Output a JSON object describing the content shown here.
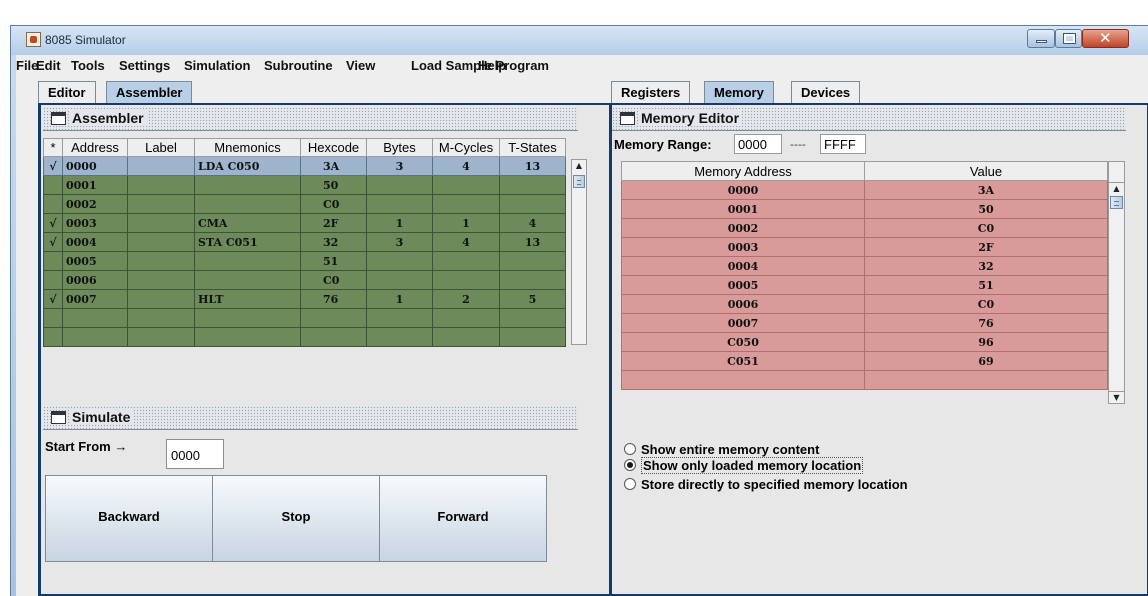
{
  "window": {
    "title": "8085 Simulator"
  },
  "menu": [
    "File",
    "Edit",
    "Tools",
    "Settings",
    "Simulation",
    "Subroutine",
    "View",
    "Load Sample Program",
    "Help"
  ],
  "left_tabs": [
    {
      "label": "Editor",
      "active": false
    },
    {
      "label": "Assembler",
      "active": true
    }
  ],
  "right_tabs": [
    {
      "label": "Registers",
      "active": false
    },
    {
      "label": "Memory",
      "active": true
    },
    {
      "label": "Devices",
      "active": false
    }
  ],
  "assembler": {
    "title": "Assembler",
    "columns": [
      "*",
      "Address",
      "Label",
      "Mnemonics",
      "Hexcode",
      "Bytes",
      "M-Cycles",
      "T-States"
    ],
    "rows": [
      {
        "mark": "√",
        "address": "0000",
        "label": "",
        "mnemonic": "LDA C050",
        "hex": "3A",
        "bytes": "3",
        "mcycles": "4",
        "tstates": "13"
      },
      {
        "mark": "",
        "address": "0001",
        "label": "",
        "mnemonic": "",
        "hex": "50",
        "bytes": "",
        "mcycles": "",
        "tstates": ""
      },
      {
        "mark": "",
        "address": "0002",
        "label": "",
        "mnemonic": "",
        "hex": "C0",
        "bytes": "",
        "mcycles": "",
        "tstates": ""
      },
      {
        "mark": "√",
        "address": "0003",
        "label": "",
        "mnemonic": "CMA",
        "hex": "2F",
        "bytes": "1",
        "mcycles": "1",
        "tstates": "4"
      },
      {
        "mark": "√",
        "address": "0004",
        "label": "",
        "mnemonic": "STA C051",
        "hex": "32",
        "bytes": "3",
        "mcycles": "4",
        "tstates": "13"
      },
      {
        "mark": "",
        "address": "0005",
        "label": "",
        "mnemonic": "",
        "hex": "51",
        "bytes": "",
        "mcycles": "",
        "tstates": ""
      },
      {
        "mark": "",
        "address": "0006",
        "label": "",
        "mnemonic": "",
        "hex": "C0",
        "bytes": "",
        "mcycles": "",
        "tstates": ""
      },
      {
        "mark": "√",
        "address": "0007",
        "label": "",
        "mnemonic": "HLT",
        "hex": "76",
        "bytes": "1",
        "mcycles": "2",
        "tstates": "5"
      },
      {
        "mark": "",
        "address": "",
        "label": "",
        "mnemonic": "",
        "hex": "",
        "bytes": "",
        "mcycles": "",
        "tstates": ""
      },
      {
        "mark": "",
        "address": "",
        "label": "",
        "mnemonic": "",
        "hex": "",
        "bytes": "",
        "mcycles": "",
        "tstates": ""
      }
    ]
  },
  "simulate": {
    "title": "Simulate",
    "start_from_label": "Start From →",
    "start_from_value": "0000",
    "buttons": {
      "backward": "Backward",
      "stop": "Stop",
      "forward": "Forward"
    }
  },
  "memory": {
    "title": "Memory Editor",
    "range_label": "Memory Range:",
    "range_start": "0000",
    "range_sep": "----",
    "range_end": "FFFF",
    "columns": [
      "Memory Address",
      "Value"
    ],
    "rows": [
      {
        "address": "0000",
        "value": "3A"
      },
      {
        "address": "0001",
        "value": "50"
      },
      {
        "address": "0002",
        "value": "C0"
      },
      {
        "address": "0003",
        "value": "2F"
      },
      {
        "address": "0004",
        "value": "32"
      },
      {
        "address": "0005",
        "value": "51"
      },
      {
        "address": "0006",
        "value": "C0"
      },
      {
        "address": "0007",
        "value": "76"
      },
      {
        "address": "C050",
        "value": "96"
      },
      {
        "address": "C051",
        "value": "69"
      },
      {
        "address": "",
        "value": ""
      }
    ],
    "options": [
      {
        "label": "Show entire memory content",
        "checked": false
      },
      {
        "label": "Show only loaded memory location",
        "checked": true
      },
      {
        "label": "Store directly to specified memory location",
        "checked": false
      }
    ]
  },
  "colors": {
    "assembler_row": "#6d8b5a",
    "selected_row": "#9db4cc",
    "memory_row": "#d99a9a",
    "pane_border": "#133a6b"
  }
}
